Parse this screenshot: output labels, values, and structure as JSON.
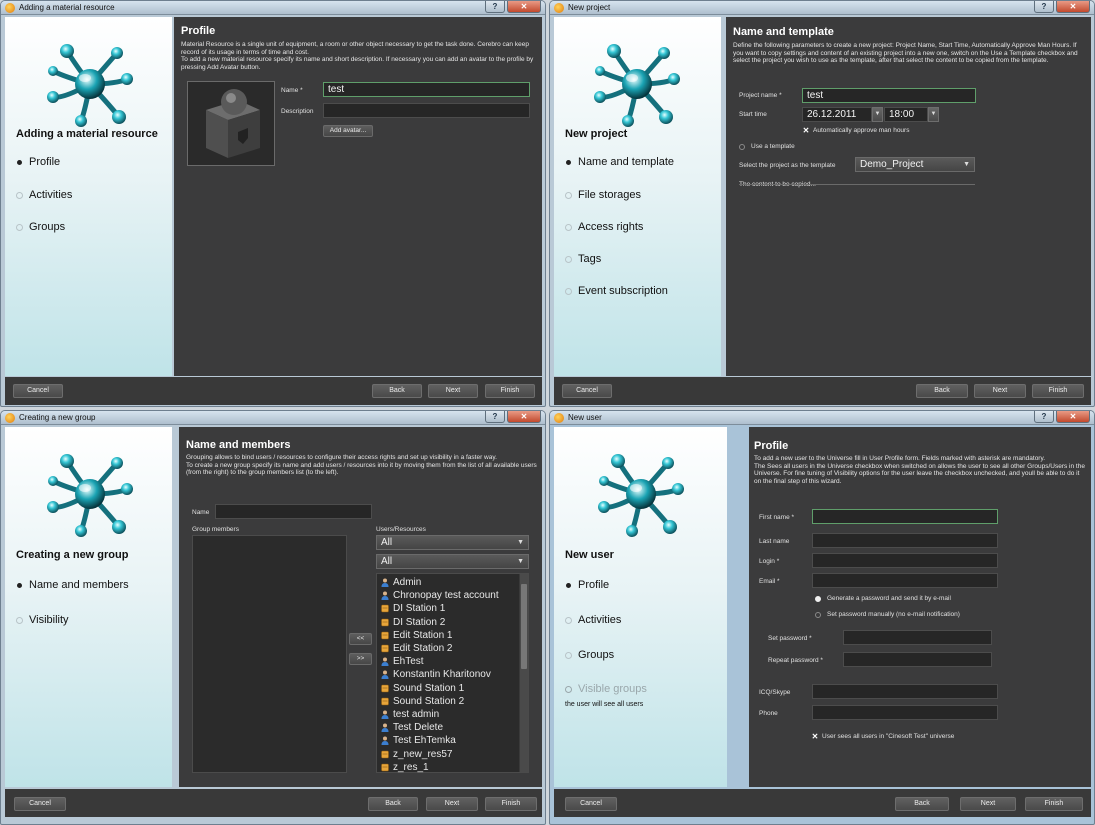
{
  "colors": {
    "content_bg": "#3b3b3c",
    "focus_border": "#5f9e6a",
    "sidebar_gradient_end": "#bfe3e8",
    "logo_teal": "#1fa5b4"
  },
  "w1": {
    "title": "Adding a material resource",
    "side_heading": "Adding a material resource",
    "steps": [
      {
        "label": "Profile",
        "selected": true
      },
      {
        "label": "Activities",
        "selected": false
      },
      {
        "label": "Groups",
        "selected": false
      }
    ],
    "heading": "Profile",
    "desc": "Material Resource is a single unit of equipment, a room or other object necessary to get the task done. Cerebro can keep record of its usage in terms of time and cost.\nTo add a new material resource specify its name and short description. If necessary you can add an avatar to the profile by pressing Add Avatar button.",
    "name_label": "Name *",
    "name_value": "test",
    "description_label": "Description",
    "description_value": "",
    "add_avatar": "Add avatar...",
    "buttons": {
      "cancel": "Cancel",
      "back": "Back",
      "next": "Next",
      "finish": "Finish"
    }
  },
  "w2": {
    "title": "New project",
    "side_heading": "New project",
    "steps": [
      {
        "label": "Name and template",
        "selected": true
      },
      {
        "label": "File storages",
        "selected": false
      },
      {
        "label": "Access rights",
        "selected": false
      },
      {
        "label": "Tags",
        "selected": false
      },
      {
        "label": "Event subscription",
        "selected": false
      }
    ],
    "heading": "Name and template",
    "desc": "Define the following parameters to create a new project: Project Name, Start Time, Automatically Approve Man Hours. If you want to copy settings and content of an existing project into a new one, switch on the Use a Template checkbox and select the project you wish to use as the template, after that select the content to be copied from the template.",
    "project_name_label": "Project name *",
    "project_name_value": "test",
    "start_time_label": "Start time",
    "start_date": "26.12.2011",
    "start_clock": "18:00",
    "auto_approve_label": "Automatically approve man hours",
    "use_template_label": "Use a template",
    "template_select_label": "Select the project as the template",
    "template_value": "Demo_Project",
    "content_copied_label": "The content to be copied...",
    "buttons": {
      "cancel": "Cancel",
      "back": "Back",
      "next": "Next",
      "finish": "Finish"
    }
  },
  "w3": {
    "title": "Creating a new group",
    "side_heading": "Creating a new group",
    "steps": [
      {
        "label": "Name and members",
        "selected": true
      },
      {
        "label": "Visibility",
        "selected": false
      }
    ],
    "heading": "Name and members",
    "desc": "Grouping allows to bind users / resources to configure their access rights and set up visibility in a faster way.\nTo create a new group specify its name and add users / resources into it by moving them from the list of all available users (from the right) to the group members list (to the left).",
    "name_label": "Name",
    "name_value": "",
    "group_members_label": "Group members",
    "users_resources_label": "Users/Resources",
    "filter1": "All",
    "filter2": "All",
    "move_left": "<<",
    "move_right": ">>",
    "resources": [
      {
        "name": "Admin",
        "kind": "user"
      },
      {
        "name": "Chronopay test account",
        "kind": "user"
      },
      {
        "name": "DI Station 1",
        "kind": "resource"
      },
      {
        "name": "DI Station 2",
        "kind": "resource"
      },
      {
        "name": "Edit Station 1",
        "kind": "resource"
      },
      {
        "name": "Edit Station 2",
        "kind": "resource"
      },
      {
        "name": "EhTest",
        "kind": "user"
      },
      {
        "name": "Konstantin Kharitonov",
        "kind": "user"
      },
      {
        "name": "Sound Station 1",
        "kind": "resource"
      },
      {
        "name": "Sound Station 2",
        "kind": "resource"
      },
      {
        "name": "test admin",
        "kind": "user"
      },
      {
        "name": "Test Delete",
        "kind": "user"
      },
      {
        "name": "Test EhTemka",
        "kind": "user"
      },
      {
        "name": "z_new_res57",
        "kind": "resource"
      },
      {
        "name": "z_res_1",
        "kind": "resource"
      }
    ],
    "buttons": {
      "cancel": "Cancel",
      "back": "Back",
      "next": "Next",
      "finish": "Finish"
    }
  },
  "w4": {
    "title": "New user",
    "side_heading": "New user",
    "steps": [
      {
        "label": "Profile",
        "selected": true
      },
      {
        "label": "Activities",
        "selected": false
      },
      {
        "label": "Groups",
        "selected": false
      },
      {
        "label": "Visible groups",
        "selected": false,
        "disabled": true
      }
    ],
    "side_note": "the user will see all users",
    "heading": "Profile",
    "desc": "To add a new user to the Universe fill in User Profile form. Fields marked with asterisk are mandatory.\nThe Sees all users in the Universe checkbox when switched on allows the user to see all other Groups/Users in the Universe. For fine tuning of Visibility options for the user leave the checkbox unchecked, and youll be able to do it on the final step of this wizard.",
    "first_name_label": "First name *",
    "last_name_label": "Last name",
    "login_label": "Login *",
    "email_label": "Email *",
    "gen_password_label": "Generate a password and send it by e-mail",
    "set_manual_label": "Set password manually (no e-mail notification)",
    "set_password_label": "Set password *",
    "repeat_password_label": "Repeat password *",
    "icq_label": "ICQ/Skype",
    "phone_label": "Phone",
    "sees_all_label": "User sees all users in \"Cinesoft Test\" universe",
    "buttons": {
      "cancel": "Cancel",
      "back": "Back",
      "next": "Next",
      "finish": "Finish"
    }
  }
}
